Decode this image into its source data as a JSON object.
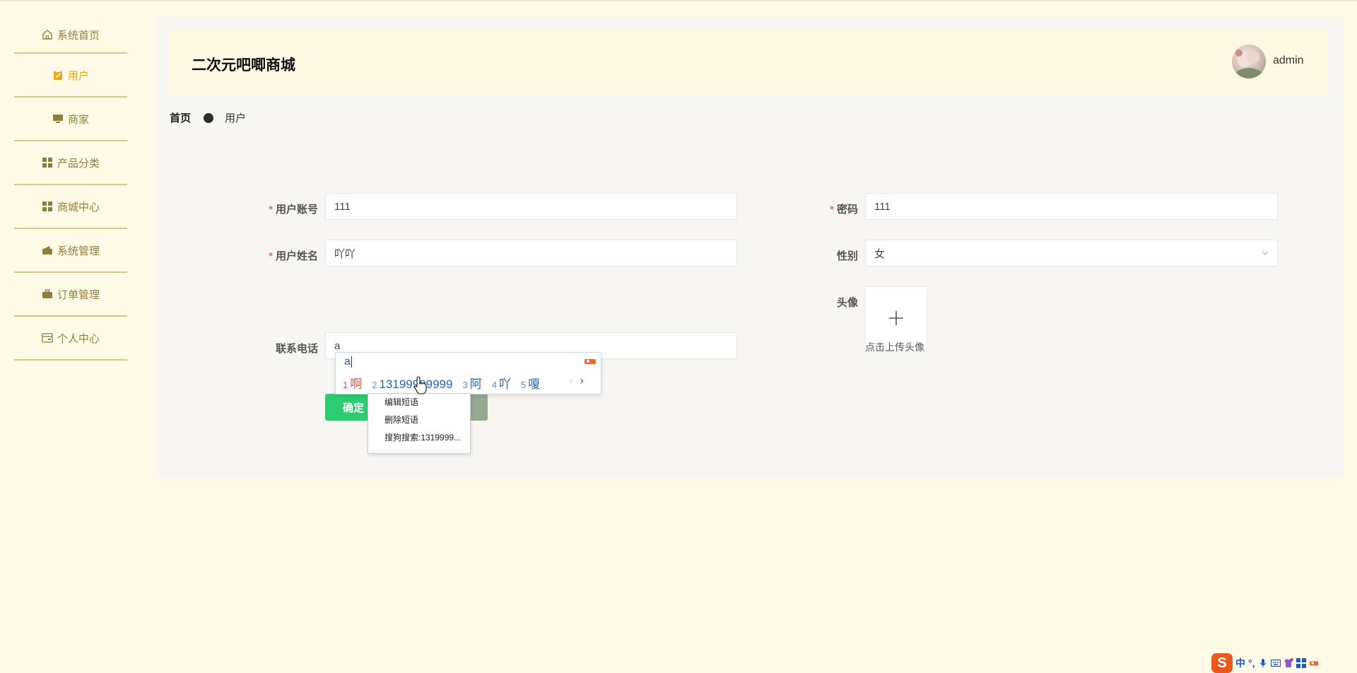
{
  "sidebar": {
    "items": [
      {
        "label": "系统首页",
        "icon": "home-icon"
      },
      {
        "label": "用户",
        "icon": "clipboard-icon",
        "active": true
      },
      {
        "label": "商家",
        "icon": "monitor-icon"
      },
      {
        "label": "产品分类",
        "icon": "grid-icon"
      },
      {
        "label": "商城中心",
        "icon": "grid-icon"
      },
      {
        "label": "系统管理",
        "icon": "wallet-icon"
      },
      {
        "label": "订单管理",
        "icon": "briefcase-icon"
      },
      {
        "label": "个人中心",
        "icon": "card-icon"
      }
    ]
  },
  "header": {
    "title": "二次元吧唧商城",
    "username": "admin"
  },
  "breadcrumb": {
    "home": "首页",
    "current": "用户"
  },
  "form": {
    "account_label": "用户账号",
    "account_value": "111",
    "password_label": "密码",
    "password_value": "111",
    "name_label": "用户姓名",
    "name_value": "吖吖",
    "gender_label": "性别",
    "gender_value": "女",
    "avatar_label": "头像",
    "upload_hint": "点击上传头像",
    "phone_label": "联系电话",
    "phone_value": "a",
    "required_mark": "*",
    "confirm_label": "确定"
  },
  "ime": {
    "composition": "a",
    "candidates": [
      {
        "num": "1",
        "text": "啊"
      },
      {
        "num": "2",
        "text": "13199999999"
      },
      {
        "num": "3",
        "text": "阿"
      },
      {
        "num": "4",
        "text": "吖"
      },
      {
        "num": "5",
        "text": "嗄"
      }
    ],
    "prev": "‹",
    "next": "›"
  },
  "context_menu": {
    "items": [
      "编辑短语",
      "删除短语",
      "搜狗搜索:1319999..."
    ]
  },
  "tray": {
    "logo": "S",
    "lang": "中",
    "punct": "°,"
  },
  "colors": {
    "accent": "#e9a91b",
    "sidebar_text": "#8f7d3c",
    "confirm": "#2ecc71",
    "background": "#fff9e8"
  }
}
